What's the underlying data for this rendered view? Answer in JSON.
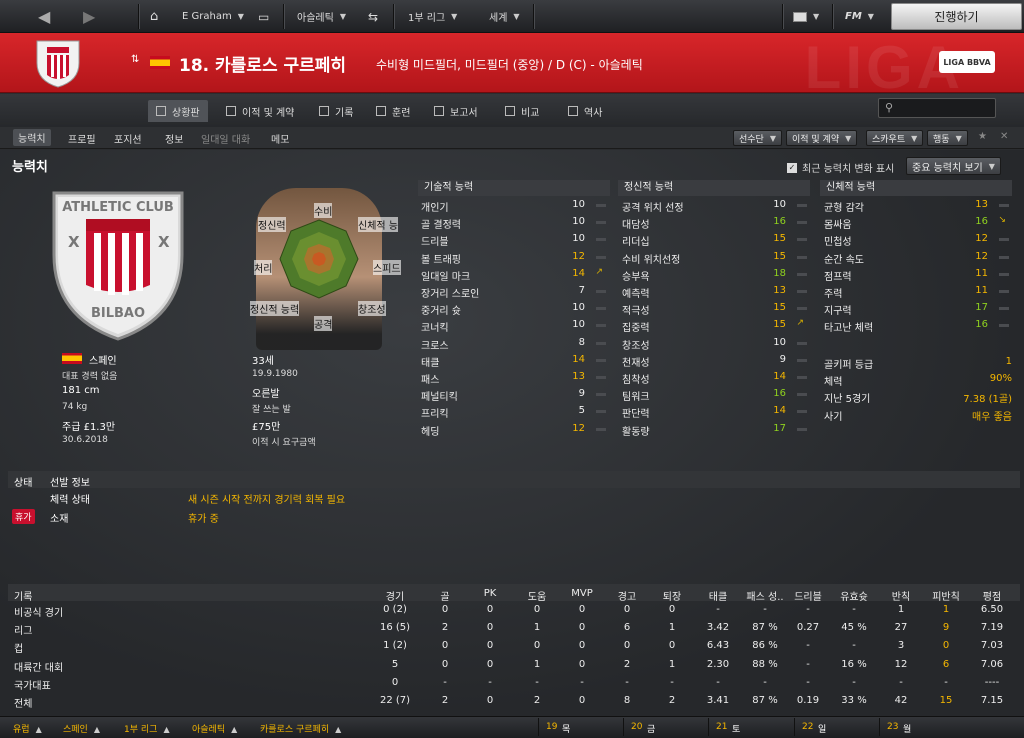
{
  "topbar": {
    "manager": "E Graham",
    "club": "아슬레틱",
    "league": "1부 리그",
    "world": "세계",
    "fm": "FM",
    "continue": "진행하기"
  },
  "header": {
    "player_name": "18. 카를로스 구르페히",
    "position": "수비형 미드필더, 미드필더 (중앙) / D (C) - 아슬레틱",
    "league_logo": "LIGA BBVA",
    "bg_text": "LIGA"
  },
  "tabs": [
    "상황판",
    "이적 및 계약",
    "기록",
    "훈련",
    "보고서",
    "비교",
    "역사"
  ],
  "subnav": {
    "items": [
      "능력치",
      "프로필",
      "포지션",
      "정보"
    ],
    "dim": "일대일 대화",
    "memo": "메모",
    "buttons": [
      "선수단",
      "이적 및 계약",
      "스카우트",
      "행동"
    ]
  },
  "section_title": "능력치",
  "options": {
    "checkbox": "최근 능력치 변화 표시",
    "checked": "✓",
    "view_btn": "중요 능력치 보기"
  },
  "crest_text": {
    "top": "ATHLETIC CLUB",
    "bottom": "BILBAO",
    "x": "X"
  },
  "radar_labels": [
    "수비",
    "신체적 능",
    "스피드",
    "창조성",
    "공격",
    "정신적 능력",
    "처리",
    "정신력"
  ],
  "player_info": {
    "nation": "스페인",
    "age": "33세",
    "intl": "대표 경력 없음",
    "dob": "19.9.1980",
    "height": "181 cm",
    "foot": "오른발",
    "weight": "74 kg",
    "foot2": "잘 쓰는 발",
    "wage": "주급 £1.3만",
    "value": "£75만",
    "contract": "30.6.2018",
    "value_note": "이적 시 요구금액"
  },
  "technical": {
    "title": "기술적 능력",
    "rows": [
      {
        "label": "개인기",
        "value": "10",
        "color": "white"
      },
      {
        "label": "골 결정력",
        "value": "10",
        "color": "white"
      },
      {
        "label": "드리블",
        "value": "10",
        "color": "white"
      },
      {
        "label": "볼 트래핑",
        "value": "12",
        "color": "yellow"
      },
      {
        "label": "일대일 마크",
        "value": "14",
        "color": "yellow",
        "arrow": "↗"
      },
      {
        "label": "장거리 스로인",
        "value": "7",
        "color": "white"
      },
      {
        "label": "중거리 슛",
        "value": "10",
        "color": "white"
      },
      {
        "label": "코너킥",
        "value": "10",
        "color": "white"
      },
      {
        "label": "크로스",
        "value": "8",
        "color": "white"
      },
      {
        "label": "태클",
        "value": "14",
        "color": "yellow"
      },
      {
        "label": "패스",
        "value": "13",
        "color": "yellow"
      },
      {
        "label": "페널티킥",
        "value": "9",
        "color": "white"
      },
      {
        "label": "프리킥",
        "value": "5",
        "color": "white"
      },
      {
        "label": "헤딩",
        "value": "12",
        "color": "yellow"
      }
    ]
  },
  "mental": {
    "title": "정신적 능력",
    "rows": [
      {
        "label": "공격 위치 선정",
        "value": "10",
        "color": "white"
      },
      {
        "label": "대담성",
        "value": "16",
        "color": "green"
      },
      {
        "label": "리더십",
        "value": "15",
        "color": "yellow"
      },
      {
        "label": "수비 위치선정",
        "value": "15",
        "color": "yellow"
      },
      {
        "label": "승부욕",
        "value": "18",
        "color": "green"
      },
      {
        "label": "예측력",
        "value": "13",
        "color": "yellow"
      },
      {
        "label": "적극성",
        "value": "15",
        "color": "yellow"
      },
      {
        "label": "집중력",
        "value": "15",
        "color": "yellow",
        "arrow": "↗"
      },
      {
        "label": "창조성",
        "value": "10",
        "color": "white"
      },
      {
        "label": "천재성",
        "value": "9",
        "color": "white"
      },
      {
        "label": "침착성",
        "value": "14",
        "color": "yellow"
      },
      {
        "label": "팀워크",
        "value": "16",
        "color": "green"
      },
      {
        "label": "판단력",
        "value": "14",
        "color": "yellow"
      },
      {
        "label": "활동량",
        "value": "17",
        "color": "green"
      }
    ]
  },
  "physical": {
    "title": "신체적 능력",
    "rows": [
      {
        "label": "균형 감각",
        "value": "13",
        "color": "yellow"
      },
      {
        "label": "몸싸움",
        "value": "16",
        "color": "green",
        "arrow": "↘"
      },
      {
        "label": "민첩성",
        "value": "12",
        "color": "yellow"
      },
      {
        "label": "순간 속도",
        "value": "12",
        "color": "yellow"
      },
      {
        "label": "점프력",
        "value": "11",
        "color": "yellow"
      },
      {
        "label": "주력",
        "value": "11",
        "color": "yellow"
      },
      {
        "label": "지구력",
        "value": "17",
        "color": "green"
      },
      {
        "label": "타고난 체력",
        "value": "16",
        "color": "green"
      }
    ]
  },
  "extra": [
    {
      "label": "골키퍼 등급",
      "value": "1"
    },
    {
      "label": "체력",
      "value": "90%"
    },
    {
      "label": "지난 5경기",
      "value": "7.38 (1골)"
    },
    {
      "label": "사기",
      "value": "매우 좋음"
    }
  ],
  "status": {
    "header_label": "상태",
    "header_value": "선발 정보",
    "fitness_label": "체력 상태",
    "fitness_value": "새 시즌 시작 전까지 경기력 회복 필요",
    "badge": "휴가",
    "misc_label": "소재",
    "misc_value": "휴가 중"
  },
  "stats": {
    "columns": [
      "기록",
      "경기",
      "골",
      "PK",
      "도움",
      "MVP",
      "경고",
      "퇴장",
      "태클",
      "패스 성..",
      "드리블",
      "유효슛",
      "반칙",
      "피반칙",
      "평점"
    ],
    "rows": [
      [
        "비공식 경기",
        "0 (2)",
        "0",
        "0",
        "0",
        "0",
        "0",
        "0",
        "-",
        "-",
        "-",
        "-",
        "1",
        "1",
        "6.50"
      ],
      [
        "리그",
        "16 (5)",
        "2",
        "0",
        "1",
        "0",
        "6",
        "1",
        "3.42",
        "87 %",
        "0.27",
        "45 %",
        "27",
        "9",
        "7.19"
      ],
      [
        "컵",
        "1 (2)",
        "0",
        "0",
        "0",
        "0",
        "0",
        "0",
        "6.43",
        "86 %",
        "-",
        "-",
        "3",
        "0",
        "7.03"
      ],
      [
        "대륙간 대회",
        "5",
        "0",
        "0",
        "1",
        "0",
        "2",
        "1",
        "2.30",
        "88 %",
        "-",
        "16 %",
        "12",
        "6",
        "7.06"
      ],
      [
        "국가대표",
        "0",
        "-",
        "-",
        "-",
        "-",
        "-",
        "-",
        "-",
        "-",
        "-",
        "-",
        "-",
        "-",
        "----"
      ],
      [
        "전체",
        "22 (7)",
        "2",
        "0",
        "2",
        "0",
        "8",
        "2",
        "3.41",
        "87 %",
        "0.19",
        "33 %",
        "42",
        "15",
        "7.15"
      ]
    ]
  },
  "footer": {
    "crumbs": [
      "유럽",
      "스페인",
      "1부 리그",
      "아슬레틱",
      "카를로스 구르페히"
    ],
    "dates": [
      {
        "n": "19",
        "d": "목"
      },
      {
        "n": "20",
        "d": "금"
      },
      {
        "n": "21",
        "d": "토"
      },
      {
        "n": "22",
        "d": "일"
      },
      {
        "n": "23",
        "d": "월"
      }
    ]
  },
  "colors": {
    "accent": "#d11f24",
    "yellow": "#f5b700",
    "green": "#8fd11f"
  }
}
